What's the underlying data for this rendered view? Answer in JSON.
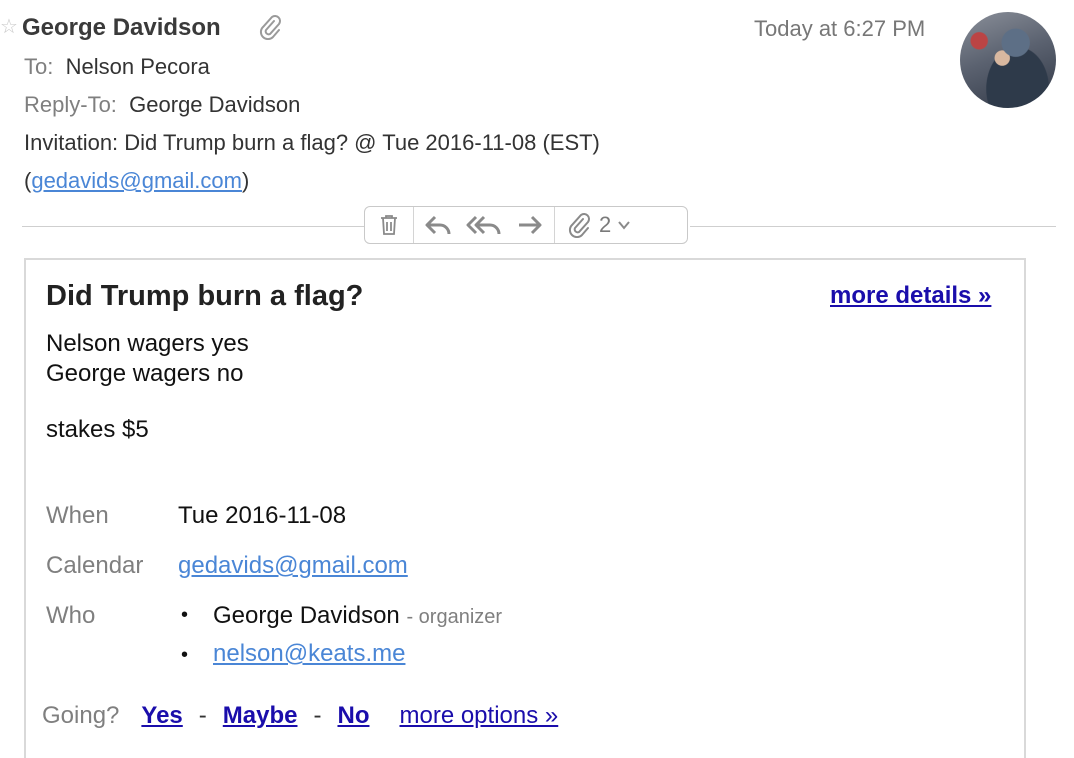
{
  "header": {
    "sender": "George Davidson",
    "time": "Today at 6:27 PM",
    "to_label": "To:",
    "to_value": "Nelson Pecora",
    "reply_to_label": "Reply-To:",
    "reply_to_value": "George Davidson",
    "subject": "Invitation: Did Trump burn a flag? @ Tue 2016-11-08 (EST)",
    "email_open": "(",
    "email": "gedavids@gmail.com",
    "email_close": ")",
    "attachment_icon": "paperclip-icon"
  },
  "toolbar": {
    "icons": [
      "trash-icon",
      "reply-icon",
      "reply-all-icon",
      "forward-icon",
      "paperclip-icon",
      "chevron-down-icon"
    ],
    "attachment_count": "2"
  },
  "invite": {
    "title": "Did Trump burn a flag?",
    "more_details": "more details »",
    "line1": "Nelson wagers yes",
    "line2": "George wagers no",
    "line3": "stakes $5",
    "when_label": "When",
    "when_value": "Tue 2016-11-08",
    "calendar_label": "Calendar",
    "calendar_value": "gedavids@gmail.com",
    "who_label": "Who",
    "guests": [
      {
        "name": "George Davidson",
        "role": "- organizer"
      },
      {
        "name": "nelson@keats.me"
      }
    ],
    "going_label": "Going?",
    "yes": "Yes",
    "maybe": "Maybe",
    "no": "No",
    "dash": "-",
    "more_options": "more options »"
  },
  "colors": {
    "link": "#4a86d6",
    "action_link": "#1a0dab",
    "muted": "#7f7f7f"
  }
}
